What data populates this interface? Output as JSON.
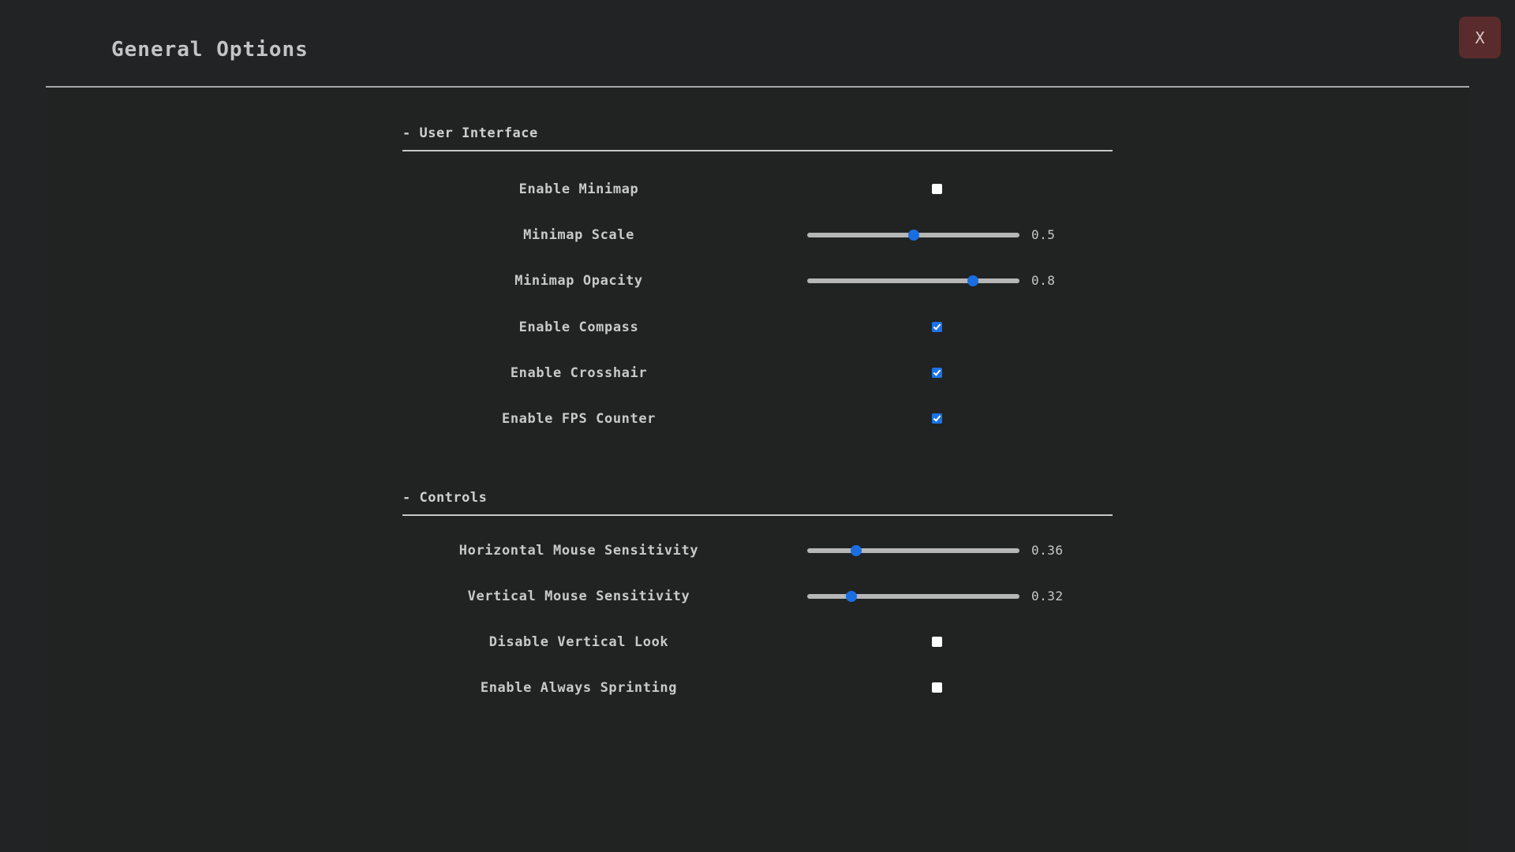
{
  "header": {
    "title": "General Options",
    "close_label": "X"
  },
  "colors": {
    "accent": "#1a73e8",
    "background": "#222324",
    "close_button_bg": "#5a2b2c"
  },
  "sections": [
    {
      "title": "- User Interface",
      "settings": [
        {
          "label": "Enable Minimap",
          "type": "checkbox",
          "checked": false
        },
        {
          "label": "Minimap Scale",
          "type": "slider",
          "value": 0.5,
          "value_text": "0.5",
          "fraction": 0.5
        },
        {
          "label": "Minimap Opacity",
          "type": "slider",
          "value": 0.8,
          "value_text": "0.8",
          "fraction": 0.78
        },
        {
          "label": "Enable Compass",
          "type": "checkbox",
          "checked": true
        },
        {
          "label": "Enable Crosshair",
          "type": "checkbox",
          "checked": true
        },
        {
          "label": "Enable FPS Counter",
          "type": "checkbox",
          "checked": true
        }
      ]
    },
    {
      "title": "- Controls",
      "settings": [
        {
          "label": "Horizontal Mouse Sensitivity",
          "type": "slider",
          "value": 0.36,
          "value_text": "0.36",
          "fraction": 0.23
        },
        {
          "label": "Vertical Mouse Sensitivity",
          "type": "slider",
          "value": 0.32,
          "value_text": "0.32",
          "fraction": 0.21
        },
        {
          "label": "Disable Vertical Look",
          "type": "checkbox",
          "checked": false
        },
        {
          "label": "Enable Always Sprinting",
          "type": "checkbox",
          "checked": false
        }
      ]
    }
  ]
}
